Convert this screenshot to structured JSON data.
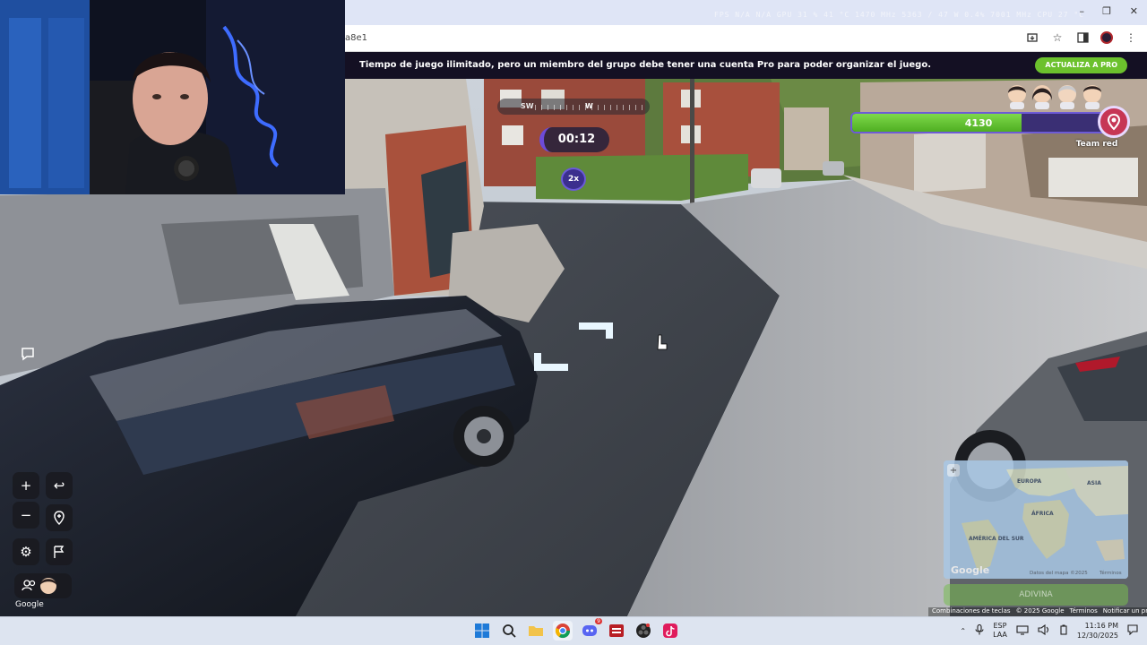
{
  "browser": {
    "url_fragment": "a8e1",
    "hw_stats": "FPS  N/A  N/A      GPU  31 %  41 °C  1470 MHz  5363 / 47 W  0.4%  7001 MHz      CPU  27 °C",
    "window_controls": {
      "minimize": "–",
      "maximize": "❐",
      "close": "✕"
    }
  },
  "promo": {
    "text": "Tiempo de juego ilimitado, pero un miembro del grupo debe tener una cuenta Pro para poder organizar el juego.",
    "button_label": "ACTUALIZA A PRO"
  },
  "compass": {
    "left_label": "SW",
    "right_label": "W"
  },
  "hud": {
    "timer": "00:12",
    "multiplier": "2x",
    "health_value": "4130",
    "health_fraction": 0.67,
    "team_label": "Team red"
  },
  "controls": {
    "zoom_in": "+",
    "zoom_out": "−",
    "back": "↩",
    "google_label": "Google"
  },
  "minimap": {
    "labels": [
      "EUROPA",
      "ASIA",
      "ÁFRICA",
      "AMÉRICA DEL SUR"
    ],
    "google_label": "Google",
    "data_text": "Datos del mapa ©2025",
    "terms_text": "Términos",
    "guess_label": "ADIVINA"
  },
  "map_footer": {
    "shortcuts": "Combinaciones de teclas",
    "copyright": "© 2025 Google",
    "terms": "Términos",
    "report": "Notificar un problema"
  },
  "taskbar": {
    "lang_top": "ESP",
    "lang_bottom": "LAA",
    "time": "11:16 PM",
    "date": "12/30/2025",
    "badge_count": "9"
  },
  "colors": {
    "accent_purple": "#6d5bd6",
    "health_green": "#5fc42f",
    "team_red": "#c63655",
    "promo_green": "#6cc12d"
  }
}
